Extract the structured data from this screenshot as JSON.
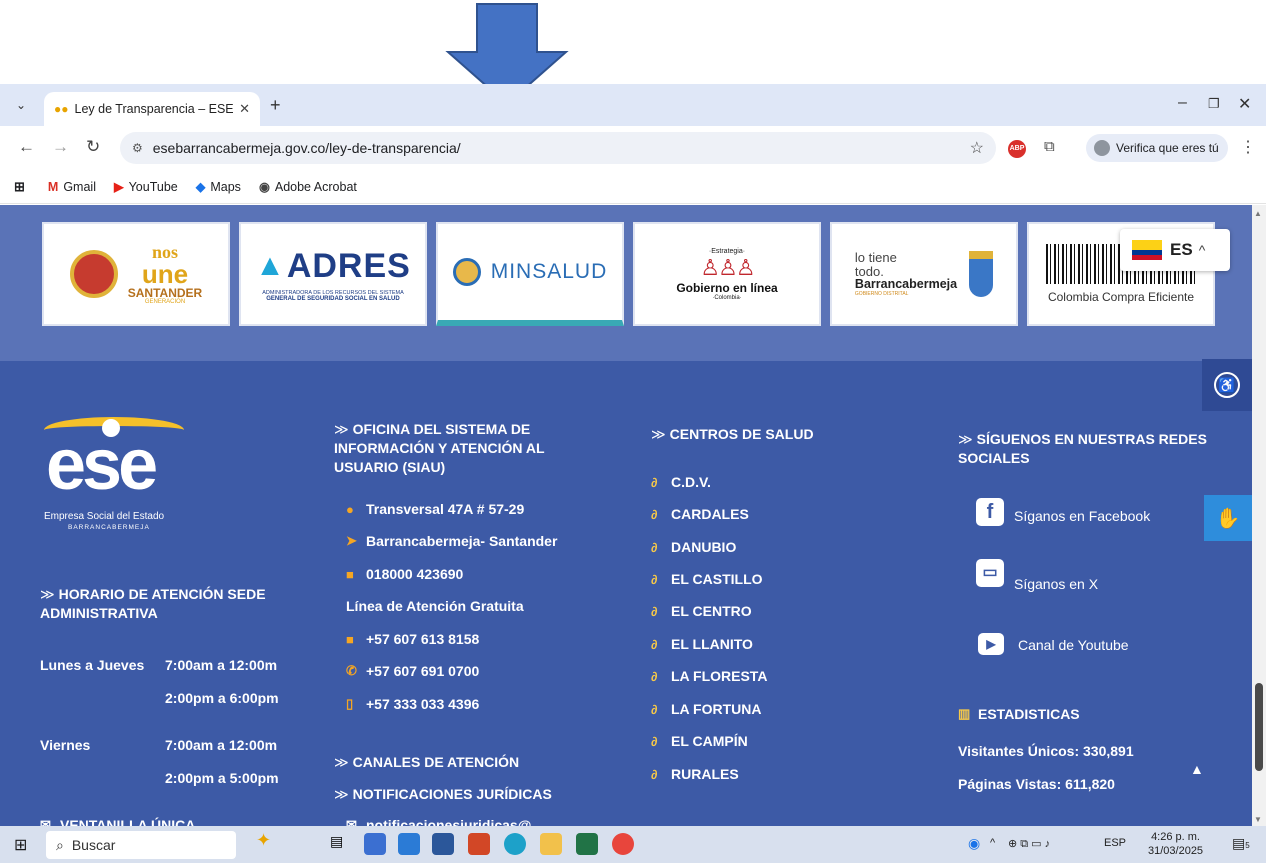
{
  "browser": {
    "tab_title": "Ley de Transparencia – ESE Barr",
    "new_tab": "+",
    "url": "esebarrancabermeja.gov.co/ley-de-transparencia/",
    "profile_label": "Verifica que eres tú",
    "abp_label": "ABP",
    "window_controls": [
      "–",
      "❐",
      "✕"
    ]
  },
  "bookmarks": [
    {
      "label": "Gmail",
      "icon": "gmail-icon",
      "glyph": "M",
      "color": "#d93025"
    },
    {
      "label": "YouTube",
      "icon": "youtube-icon",
      "glyph": "▶",
      "color": "#e62117"
    },
    {
      "label": "Maps",
      "icon": "maps-icon",
      "glyph": "📍",
      "color": "#1a73e8"
    },
    {
      "label": "Adobe Acrobat",
      "icon": "acrobat-icon",
      "glyph": "◉",
      "color": "#444444"
    }
  ],
  "logos": {
    "santander": {
      "line1": "nos",
      "line2": "une",
      "line3": "SANTANDER",
      "line4": "GENERACIÓN"
    },
    "adres": {
      "name": "ADRES",
      "sub1": "ADMINISTRADORA DE LOS RECURSOS DEL SISTEMA",
      "sub2": "GENERAL DE SEGURIDAD SOCIAL EN SALUD"
    },
    "minsalud": {
      "name": "MINSALUD"
    },
    "gobierno": {
      "top": "·Estrategia·",
      "name": "Gobierno en línea",
      "bottom": "·Colombia·"
    },
    "barranca": {
      "l1": "lo tiene",
      "l2": "todo.",
      "l3": "Barrancabermeja",
      "l4": "GOBIERNO DISTRITAL"
    },
    "compra": {
      "name": "Colombia Compra Eficiente"
    }
  },
  "language": {
    "code": "ES"
  },
  "footer": {
    "org_name": "ese",
    "org_sub1": "Empresa Social del Estado",
    "org_sub2": "BARRANCABERMEJA",
    "horario_title": "HORARIO DE ATENCIÓN SEDE ADMINISTRATIVA",
    "horario": [
      {
        "day": "Lunes a Jueves",
        "times": [
          "7:00am a 12:00m",
          "2:00pm a 6:00pm"
        ]
      },
      {
        "day": "Viernes",
        "times": [
          "7:00am a 12:00m",
          "2:00pm a 5:00pm"
        ]
      }
    ],
    "ventanilla": "VENTANILLA ÚNICA",
    "siau_title": "OFICINA DEL SISTEMA DE INFORMACIÓN Y ATENCIÓN AL USUARIO (SIAU)",
    "address": "Transversal 47A # 57-29",
    "city": "Barrancabermeja- Santander",
    "toll_free": "018000 423690",
    "toll_free_label": "Línea de Atención Gratuita",
    "phone1": "+57 607 613 8158",
    "phone2": "+57 607 691 0700",
    "mobile": "+57 333 033 4396",
    "canales": "CANALES DE ATENCIÓN",
    "notificaciones": "NOTIFICACIONES JURÍDICAS",
    "notif_email": "notificacionesjuridicas@",
    "centros_title": "CENTROS DE SALUD",
    "centros": [
      "C.D.V.",
      "CARDALES",
      "DANUBIO",
      "EL CASTILLO",
      "EL CENTRO",
      "EL LLANITO",
      "LA FLORESTA",
      "LA FORTUNA",
      "EL CAMPÍN",
      "RURALES"
    ],
    "redes_title": "SÍGUENOS EN NUESTRAS REDES SOCIALES",
    "facebook": "Síganos en Facebook",
    "twitter": "Síganos en X",
    "youtube": "Canal de Youtube",
    "stats_title": "ESTADISTICAS",
    "visitantes": "Visitantes Únicos: 330,891",
    "paginas": "Páginas Vistas: 611,820"
  },
  "taskbar": {
    "search_placeholder": "Buscar",
    "lang": "ESP",
    "time": "4:26 p. m.",
    "date": "31/03/2025",
    "notif_count": "5"
  },
  "colors": {
    "footer_bg": "#3d5aa6",
    "logo_band": "#5a73b7",
    "accent_orange": "#f5a623"
  }
}
